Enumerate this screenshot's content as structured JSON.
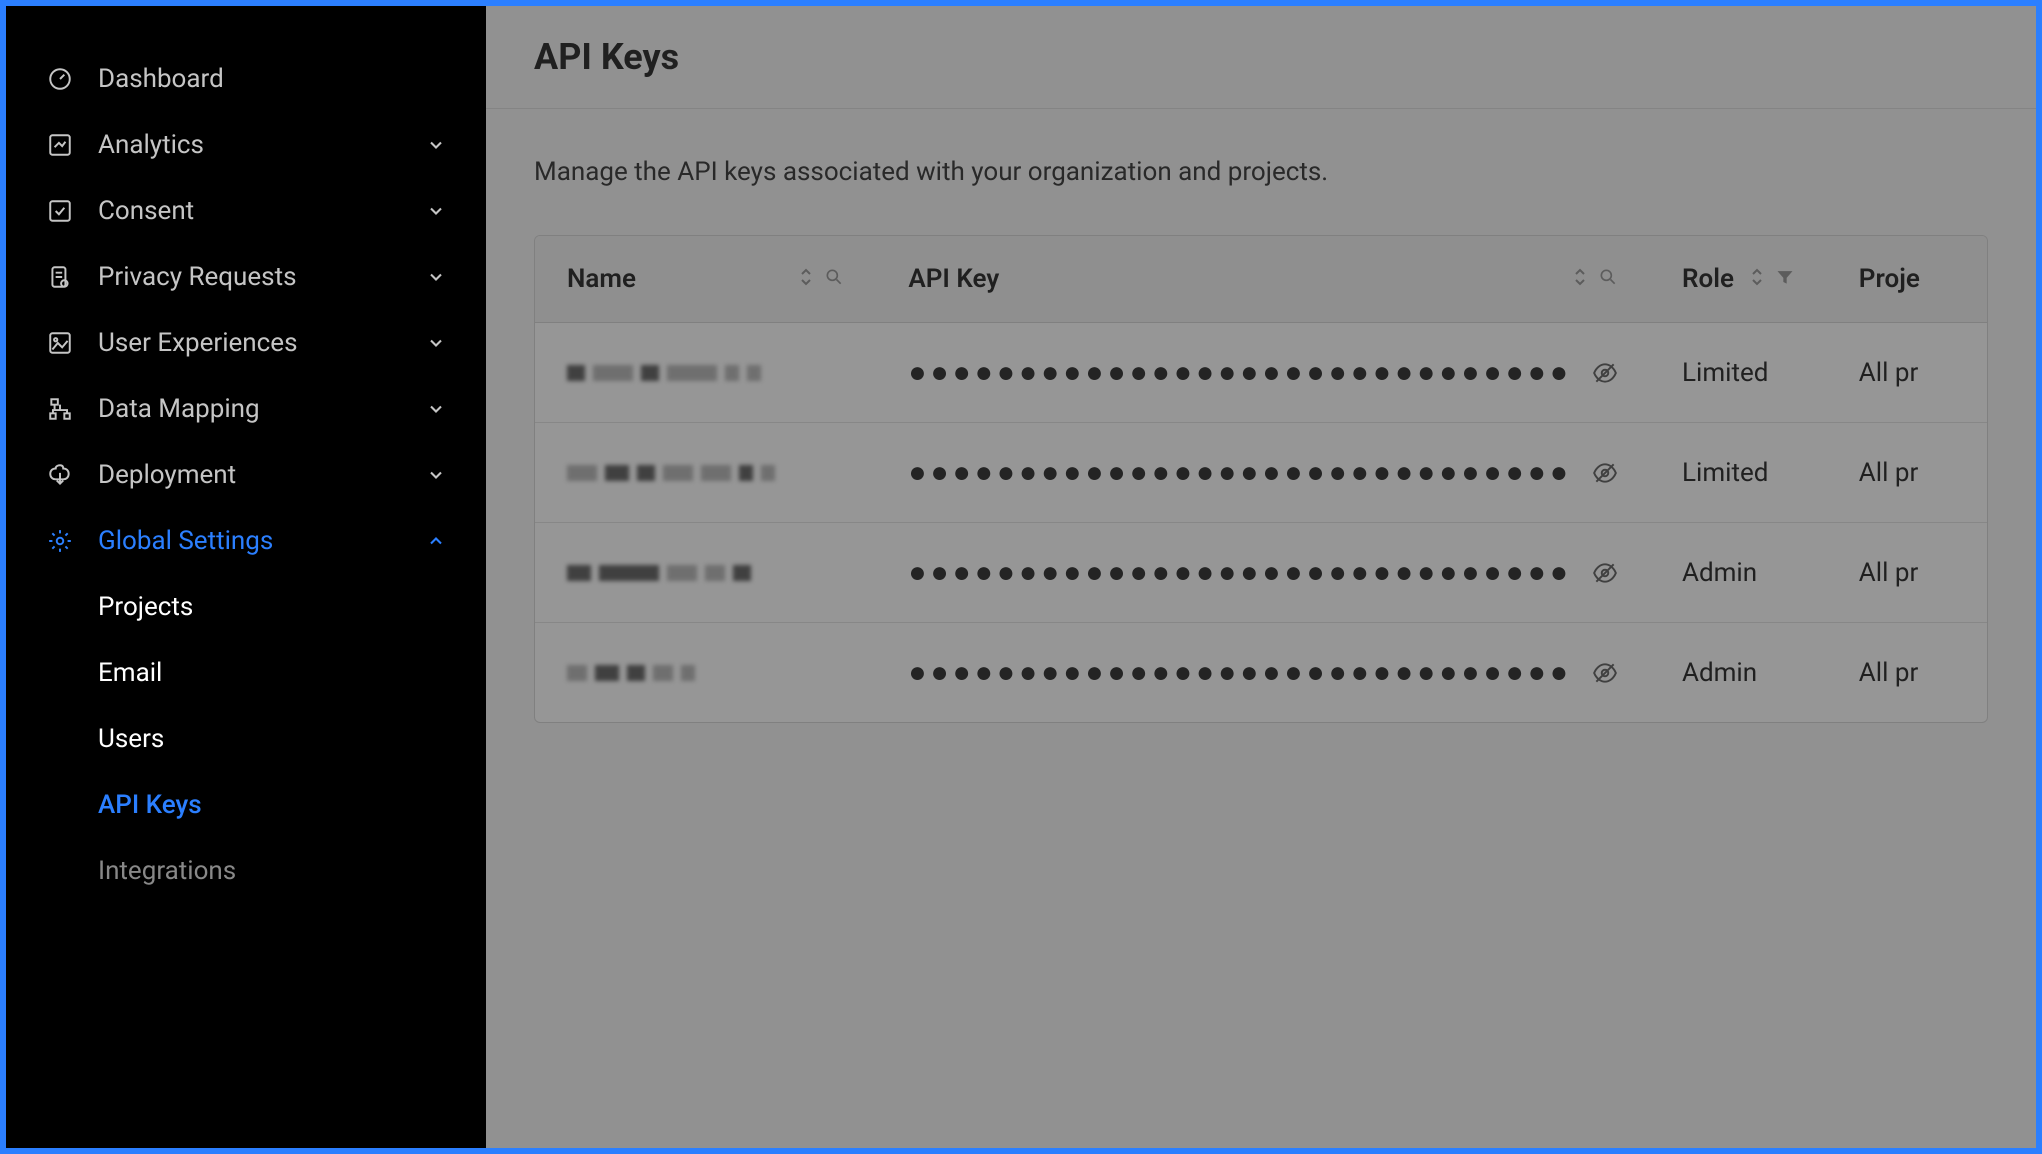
{
  "sidebar": {
    "items": [
      {
        "label": "Dashboard",
        "icon": "dashboard",
        "expandable": false
      },
      {
        "label": "Analytics",
        "icon": "analytics",
        "expandable": true
      },
      {
        "label": "Consent",
        "icon": "consent",
        "expandable": true
      },
      {
        "label": "Privacy Requests",
        "icon": "privacy",
        "expandable": true
      },
      {
        "label": "User Experiences",
        "icon": "experiences",
        "expandable": true
      },
      {
        "label": "Data Mapping",
        "icon": "datamapping",
        "expandable": true
      },
      {
        "label": "Deployment",
        "icon": "deployment",
        "expandable": true
      },
      {
        "label": "Global Settings",
        "icon": "settings",
        "expandable": true,
        "active": true,
        "expanded": true
      }
    ],
    "globalSettingsSub": [
      {
        "label": "Projects"
      },
      {
        "label": "Email"
      },
      {
        "label": "Users"
      },
      {
        "label": "API Keys",
        "active": true
      },
      {
        "label": "Integrations",
        "faded": true
      }
    ]
  },
  "page": {
    "title": "API Keys",
    "description": "Manage the API keys associated with your organization and projects."
  },
  "table": {
    "columns": {
      "name": "Name",
      "apiKey": "API Key",
      "role": "Role",
      "projects": "Proje"
    },
    "rows": [
      {
        "name_redacted": true,
        "key_masked": "●●●●●●●●●●●●●●●●●●●●●●●●●●●●●●",
        "role": "Limited",
        "projects": "All pr"
      },
      {
        "name_redacted": true,
        "key_masked": "●●●●●●●●●●●●●●●●●●●●●●●●●●●●●●",
        "role": "Limited",
        "projects": "All pr"
      },
      {
        "name_redacted": true,
        "key_masked": "●●●●●●●●●●●●●●●●●●●●●●●●●●●●●●",
        "role": "Admin",
        "projects": "All pr"
      },
      {
        "name_redacted": true,
        "key_masked": "●●●●●●●●●●●●●●●●●●●●●●●●●●●●●●",
        "role": "Admin",
        "projects": "All pr"
      }
    ]
  }
}
